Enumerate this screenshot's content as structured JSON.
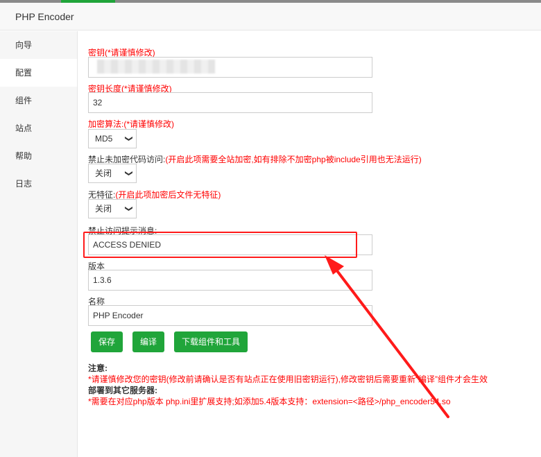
{
  "window": {
    "title": "PHP Encoder"
  },
  "sidebar": {
    "items": [
      {
        "label": "向导"
      },
      {
        "label": "配置"
      },
      {
        "label": "组件"
      },
      {
        "label": "站点"
      },
      {
        "label": "帮助"
      },
      {
        "label": "日志"
      }
    ],
    "active": "配置"
  },
  "form": {
    "key": {
      "label": "密钥(*请谨慎修改)",
      "value": ""
    },
    "key_length": {
      "label": "密钥长度(*请谨慎修改)",
      "value": "32"
    },
    "algorithm": {
      "label": "加密算法:(*请谨慎修改)",
      "value": "MD5"
    },
    "deny_unencrypted": {
      "label": "禁止未加密代码访问:",
      "hint": "(开启此项需要全站加密,如有排除不加密php被include引用也无法运行)",
      "value": "关闭"
    },
    "no_signature": {
      "label": "无特征:",
      "hint": "(开启此项加密后文件无特征)",
      "value": "关闭"
    },
    "deny_message": {
      "label": "禁止访问提示消息:",
      "value": "ACCESS DENIED"
    },
    "version": {
      "label": "版本",
      "value": "1.3.6"
    },
    "name": {
      "label": "名称",
      "value": "PHP Encoder"
    }
  },
  "buttons": {
    "save": "保存",
    "compile": "编译",
    "download": "下载组件和工具"
  },
  "notes": {
    "notice_title": "注意:",
    "notice_text": "*请谨慎修改您的密钥(修改前请确认是否有站点正在使用旧密钥运行),修改密钥后需要重新“编译”组件才会生效",
    "deploy_title": "部署到其它服务器:",
    "deploy_text": "*需要在对应php版本 php.ini里扩展支持;如添加5.4版本支持：extension=<路径>/php_encoder54.so"
  },
  "colors": {
    "accent_green": "#20a53a",
    "warning_red": "#ff0000",
    "annotation_red": "#ff1a1a"
  },
  "icons": {
    "select": "chevron-down-icon"
  }
}
